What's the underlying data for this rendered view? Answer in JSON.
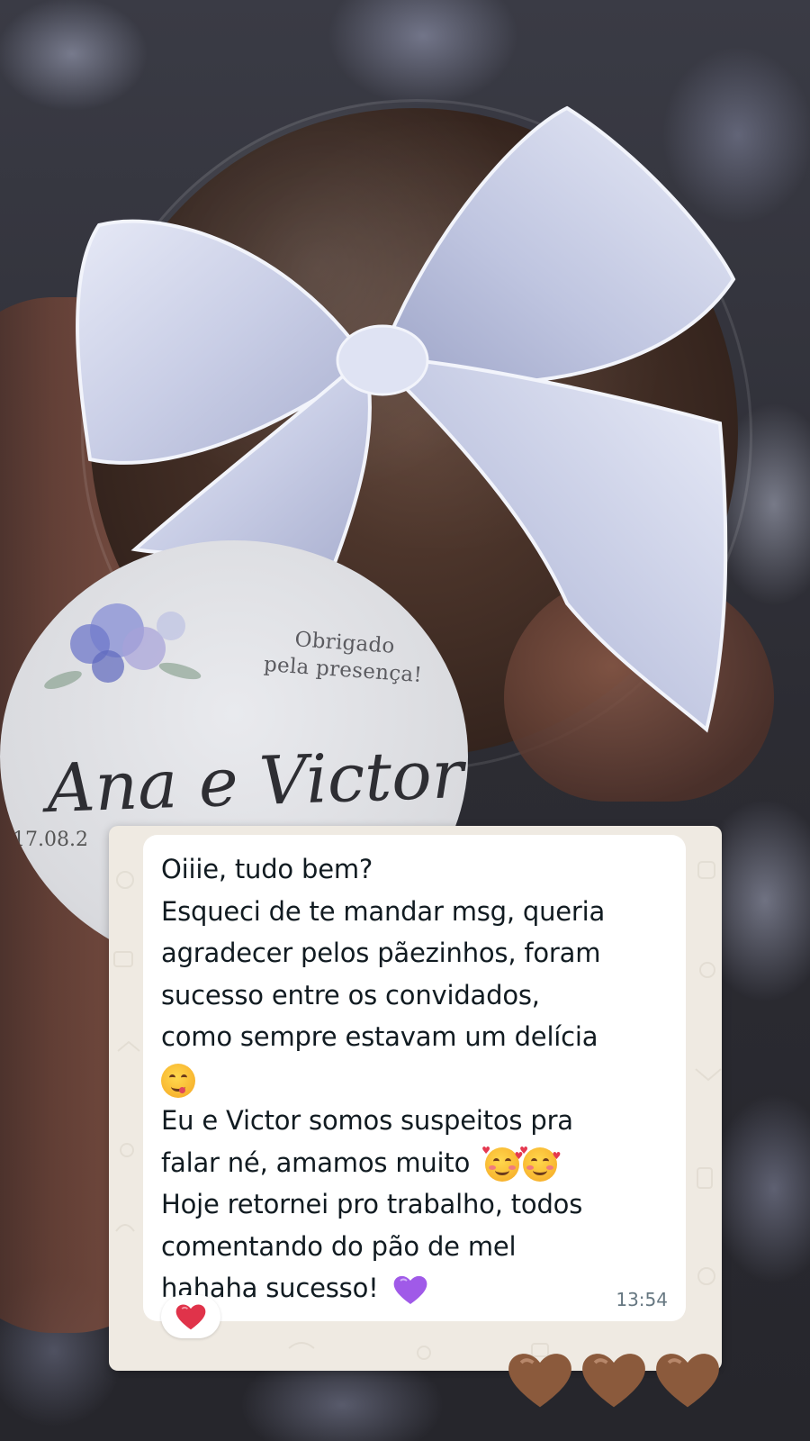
{
  "sticker": {
    "thanks_line1": "Obrigado",
    "thanks_line2": "pela presença!",
    "names": "Ana e Victor",
    "date": "17.08.2"
  },
  "message": {
    "lines": [
      "Oiiie, tudo bem?",
      "Esqueci de te mandar msg, queria",
      "agradecer pelos pãezinhos, foram",
      "sucesso entre os convidados,",
      "como sempre estavam um delícia",
      "",
      "Eu e Victor somos suspeitos pra",
      "falar né, amamos muito",
      "Hoje retornei pro trabalho, todos",
      "comentando do pão de mel",
      "hahaha sucesso!"
    ],
    "time": "13:54",
    "reaction_icon": "red-heart-icon"
  },
  "decorations": {
    "emoji": [
      "face-savoring-food-icon",
      "smiling-face-with-hearts-icon",
      "purple-heart-icon"
    ],
    "overlay_hearts": [
      "brown-heart-icon",
      "brown-heart-icon",
      "brown-heart-icon"
    ],
    "colors": {
      "chat_bg": "#efeae2",
      "bubble": "#ffffff",
      "text": "#111b21",
      "timestamp": "#667781",
      "ribbon": "#d4d9ee",
      "brown_heart": "#8b5a3c",
      "purple_heart": "#a05ae8",
      "red_heart": "#e0334a"
    }
  }
}
